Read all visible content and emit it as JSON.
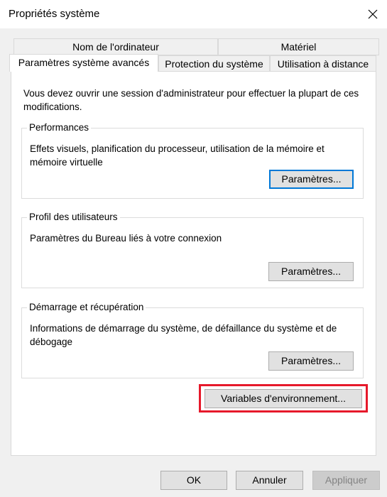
{
  "window": {
    "title": "Propriétés système",
    "close_icon": "close-icon"
  },
  "tabs": {
    "computer_name": "Nom de l'ordinateur",
    "hardware": "Matériel",
    "advanced": "Paramètres système avancés",
    "system_protection": "Protection du système",
    "remote": "Utilisation à distance",
    "active": "advanced"
  },
  "advanced": {
    "notice": "Vous devez ouvrir une session d'administrateur pour effectuer la plupart de ces modifications.",
    "performance": {
      "title": "Performances",
      "description": "Effets visuels, planification du processeur, utilisation de la mémoire et mémoire virtuelle",
      "button": "Paramètres..."
    },
    "user_profiles": {
      "title": "Profil des utilisateurs",
      "description": "Paramètres du Bureau liés à votre connexion",
      "button": "Paramètres..."
    },
    "startup_recovery": {
      "title": "Démarrage et récupération",
      "description": "Informations de démarrage du système, de défaillance du système et de débogage",
      "button": "Paramètres..."
    },
    "env_vars_button": "Variables d'environnement..."
  },
  "footer": {
    "ok": "OK",
    "cancel": "Annuler",
    "apply": "Appliquer"
  },
  "colors": {
    "focus_border": "#0078d7",
    "highlight_border": "#e6192b",
    "dialog_bg": "#f0f0f0",
    "panel_bg": "#ffffff"
  }
}
